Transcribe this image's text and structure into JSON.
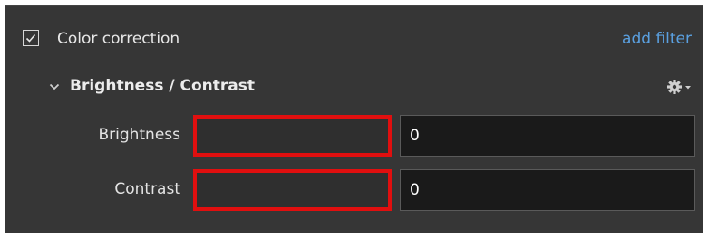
{
  "filter": {
    "name": "Color correction",
    "enabled": true,
    "add_filter_label": "add filter"
  },
  "section": {
    "title": "Brightness / Contrast",
    "expanded": true,
    "settings_icon": "gear-icon"
  },
  "params": [
    {
      "label": "Brightness",
      "value": "0"
    },
    {
      "label": "Contrast",
      "value": "0"
    }
  ],
  "colors": {
    "panel_bg": "#363636",
    "input_bg": "#1a1a1a",
    "link": "#5aa0e0",
    "highlight": "#e10f0f"
  }
}
